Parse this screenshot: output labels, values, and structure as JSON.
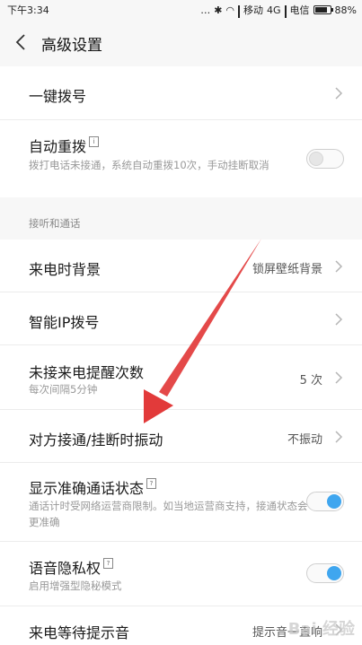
{
  "status_bar": {
    "time": "下午3:34",
    "carrier1": "移动",
    "network": "4G",
    "carrier2": "电信",
    "battery": "88%"
  },
  "header": {
    "title": "高级设置"
  },
  "section1": {
    "one_key_dial": {
      "label": "一键拨号"
    },
    "auto_redial": {
      "label": "自动重拨",
      "info_badge": "i",
      "description": "拨打电话未接通，系统自动重拨10次，手动挂断取消",
      "toggle_state": "off"
    }
  },
  "section2": {
    "header": "接听和通话",
    "incoming_bg": {
      "label": "来电时背景",
      "value": "锁屏壁纸背景"
    },
    "smart_ip": {
      "label": "智能IP拨号"
    },
    "missed_reminder": {
      "label": "未接来电提醒次数",
      "description": "每次间隔5分钟",
      "value": "5 次"
    },
    "vibrate": {
      "label": "对方接通/挂断时振动",
      "value": "不振动"
    },
    "call_status": {
      "label": "显示准确通话状态",
      "info_badge": "?",
      "description": "通话计时受网络运营商限制。如当地运营商支持，接通状态会更准确",
      "toggle_state": "on"
    },
    "voice_privacy": {
      "label": "语音隐私权",
      "info_badge": "?",
      "description": "启用增强型隐秘模式",
      "toggle_state": "on"
    },
    "call_waiting_tone": {
      "label": "来电等待提示音",
      "value": "提示音一直响"
    }
  },
  "colors": {
    "toggle_on": "#3fa6ef",
    "arrow": "#e23a3a",
    "background": "#f7f7f7"
  },
  "watermark": "Bai 经验"
}
